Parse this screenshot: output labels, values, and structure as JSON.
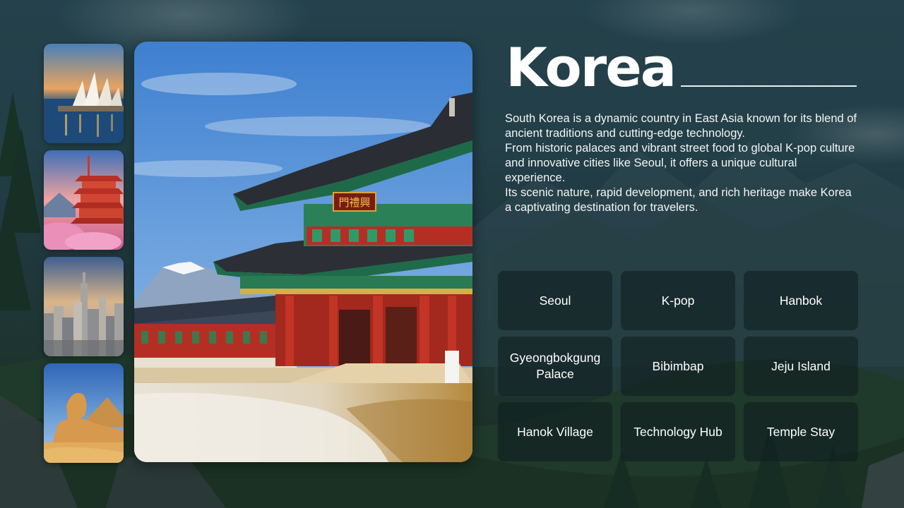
{
  "title": "Korea",
  "description": [
    "South Korea is a dynamic country in East Asia known for its blend of ancient traditions and cutting-edge technology.",
    "From historic palaces and vibrant street food to global K-pop culture and innovative cities like Seoul, it offers a unique cultural experience.",
    "Its scenic nature, rapid development, and rich heritage make Korea a captivating destination for travelers."
  ],
  "thumbnails": [
    "sydney-opera-house",
    "japan-pagoda-mount-fuji",
    "new-york-skyline",
    "egypt-sphinx"
  ],
  "hero_image": "gyeongbokgung-palace-gate",
  "hero_sign": "門禮興",
  "tiles": [
    "Seoul",
    "K-pop",
    "Hanbok",
    "Gyeongbokgung Palace",
    "Bibimbap",
    "Jeju Island",
    "Hanok Village",
    "Technology Hub",
    "Temple Stay"
  ],
  "colors": {
    "title": "#ffffff",
    "tile_background": "rgba(16,30,32,0.62)",
    "rule": "#e8eef0"
  }
}
